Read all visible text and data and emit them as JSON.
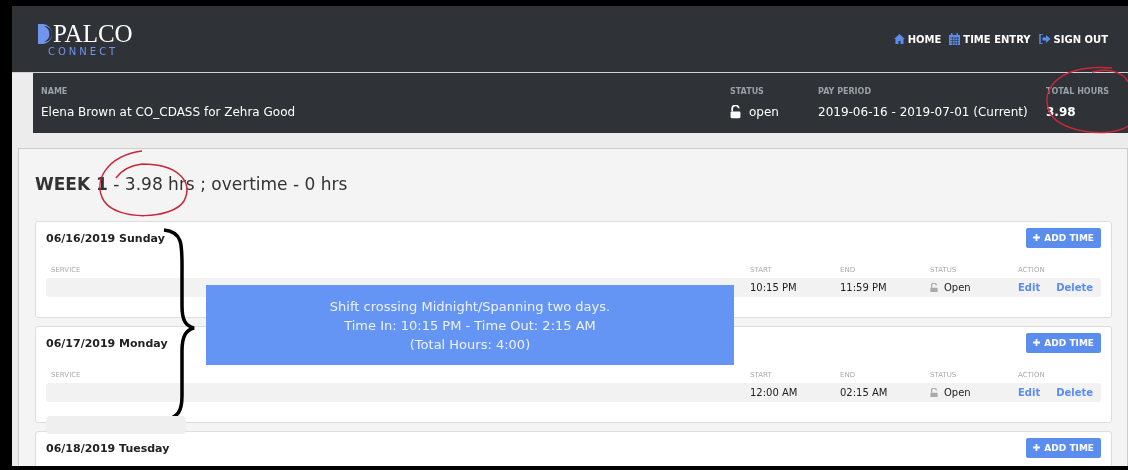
{
  "header": {
    "logo": {
      "name": "PALCO",
      "tagline": "CONNECT"
    },
    "nav": [
      {
        "label": "HOME",
        "kind": "home"
      },
      {
        "label": "TIME ENTRY",
        "kind": "calendar"
      },
      {
        "label": "SIGN OUT",
        "kind": "signout"
      }
    ]
  },
  "info_bar": {
    "fields": [
      {
        "label": "NAME",
        "value": "Elena Brown at CO_CDASS for Zehra Good",
        "kind": "text"
      },
      {
        "label": "STATUS",
        "value": "open",
        "kind": "lock"
      },
      {
        "label": "PAY PERIOD",
        "value": "2019-06-16 - 2019-07-01 (Current)",
        "kind": "text"
      },
      {
        "label": "TOTAL HOURS",
        "value": "3.98",
        "kind": "bold"
      }
    ]
  },
  "week": {
    "title": "**WEEK 1** - 3.98 hrs ; overtime - 0 hrs",
    "days": [
      {
        "date": "06/16/2019 Sunday",
        "button": "ADD TIME",
        "columns": [
          "SERVICE",
          "START",
          "END",
          "STATUS",
          "ACTION"
        ],
        "entries": [
          {
            "start": "10:15 PM",
            "end": "11:59 PM",
            "status": "Open",
            "actions": [
              "Edit",
              "Delete"
            ]
          }
        ]
      },
      {
        "date": "06/17/2019 Monday",
        "button": "ADD TIME",
        "columns": [
          "SERVICE",
          "START",
          "END",
          "STATUS",
          "ACTION"
        ],
        "entries": [
          {
            "start": "12:00 AM",
            "end": "02:15 AM",
            "status": "Open",
            "actions": [
              "Edit",
              "Delete"
            ]
          }
        ]
      },
      {
        "date": "06/18/2019 Tuesday",
        "button": "ADD TIME"
      }
    ]
  },
  "callout": {
    "lines": [
      "Shift crossing Midnight/Spanning two days.",
      "Time In: 10:15 PM - Time Out: 2:15 AM",
      "(Total Hours: 4:00)"
    ]
  }
}
